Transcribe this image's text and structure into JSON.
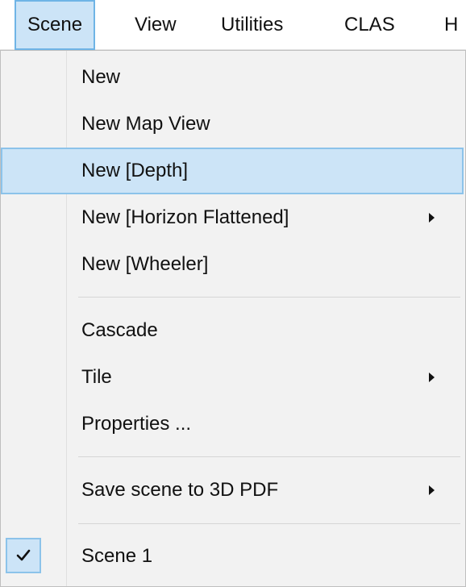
{
  "menubar": {
    "items": [
      {
        "label": "Scene"
      },
      {
        "label": "View"
      },
      {
        "label": "Utilities"
      },
      {
        "label": "CLAS"
      },
      {
        "label": "H"
      }
    ]
  },
  "dropdown": {
    "items": [
      {
        "label": "New"
      },
      {
        "label": "New Map View"
      },
      {
        "label": "New [Depth]",
        "highlighted": true
      },
      {
        "label": "New [Horizon Flattened]",
        "submenu": true
      },
      {
        "label": "New [Wheeler]"
      },
      {
        "label": "Cascade"
      },
      {
        "label": "Tile",
        "submenu": true
      },
      {
        "label": "Properties ..."
      },
      {
        "label": "Save scene to 3D PDF",
        "submenu": true
      },
      {
        "label": "Scene 1",
        "checked": true
      }
    ]
  },
  "colors": {
    "highlight_bg": "#cce4f7",
    "highlight_border": "#8cc3ea",
    "menu_bg": "#f2f2f2",
    "text": "#111111"
  },
  "icons": {
    "submenu": "submenu-arrow-icon",
    "check": "checkmark-icon"
  }
}
